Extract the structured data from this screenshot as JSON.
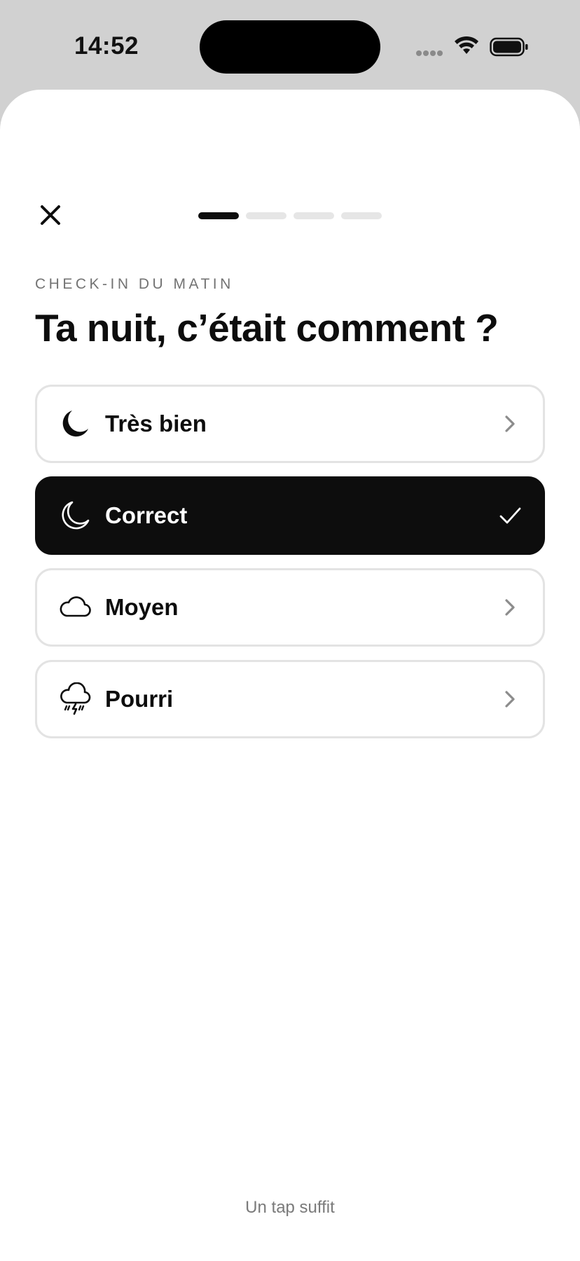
{
  "status_bar": {
    "time": "14:52"
  },
  "header": {
    "close_icon": "close-icon",
    "progress": {
      "total_steps": 4,
      "current_step": 1
    }
  },
  "eyebrow": "CHECK-IN DU MATIN",
  "title": "Ta nuit, c’était comment ?",
  "options": [
    {
      "label": "Très bien",
      "icon": "moon-filled-icon",
      "selected": false
    },
    {
      "label": "Correct",
      "icon": "moon-outline-icon",
      "selected": true
    },
    {
      "label": "Moyen",
      "icon": "cloud-icon",
      "selected": false
    },
    {
      "label": "Pourri",
      "icon": "cloud-storm-icon",
      "selected": false
    }
  ],
  "footer_hint": "Un tap suffit",
  "colors": {
    "primary": "#0d0d0d",
    "muted": "#737373",
    "border": "#e3e3e3",
    "backdrop": "#d1d1d1"
  }
}
